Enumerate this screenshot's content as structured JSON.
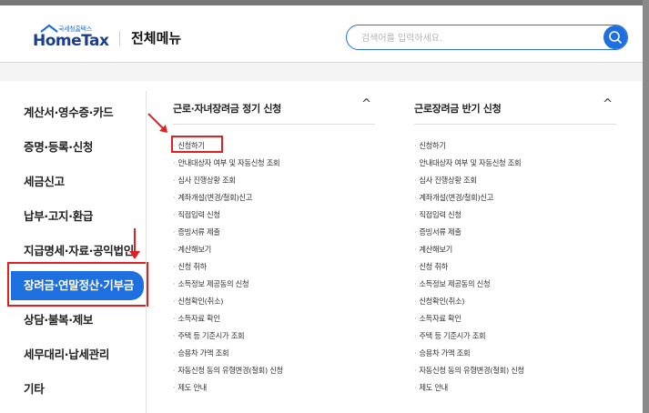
{
  "header": {
    "logo_small": "국세청홈택스",
    "logo_main": "HomeTax",
    "title": "전체메뉴",
    "search_placeholder": "검색어를 입력하세요."
  },
  "sidebar": {
    "items": [
      {
        "label": "계산서·영수증·카드"
      },
      {
        "label": "증명·등록·신청"
      },
      {
        "label": "세금신고"
      },
      {
        "label": "납부·고지·환급"
      },
      {
        "label": "지급명세·자료·공익법인"
      },
      {
        "label": "장려금·연말정산·기부금",
        "active": true
      },
      {
        "label": "상담·불복·제보"
      },
      {
        "label": "세무대리·납세관리"
      },
      {
        "label": "기타"
      }
    ]
  },
  "columns": [
    {
      "title": "근로·자녀장려금 정기 신청",
      "toggle": "^",
      "items": [
        "신청하기",
        "안내대상자 여부 및 자동신청 조회",
        "심사 진행상황 조회",
        "계좌개설(변경/철회)신고",
        "직접입력 신청",
        "증빙서류 제출",
        "계산해보기",
        "신청 취하",
        "소득정보 제공동의 신청",
        "신청확인(취소)",
        "소득자료 확인",
        "주택 등 기준시가 조회",
        "승용차 가액 조회",
        "자동신청 동의 유형변경(철회) 신청",
        "제도 안내"
      ]
    },
    {
      "title": "근로장려금 반기 신청",
      "toggle": "^",
      "items": [
        "신청하기",
        "안내대상자 여부 및 자동신청 조회",
        "심사 진행상황 조회",
        "계좌개설(변경/철회)신고",
        "직접입력 신청",
        "증빙서류 제출",
        "계산해보기",
        "신청 취하",
        "소득정보 제공동의 신청",
        "신청확인(취소)",
        "소득자료 확인",
        "주택 등 기준시가 조회",
        "승용차 가액 조회",
        "자동신청 동의 유형변경(철회) 신청",
        "제도 안내"
      ]
    }
  ],
  "colors": {
    "accent": "#1e6fe0",
    "highlight": "#e02020",
    "logo": "#1b3f8f"
  }
}
